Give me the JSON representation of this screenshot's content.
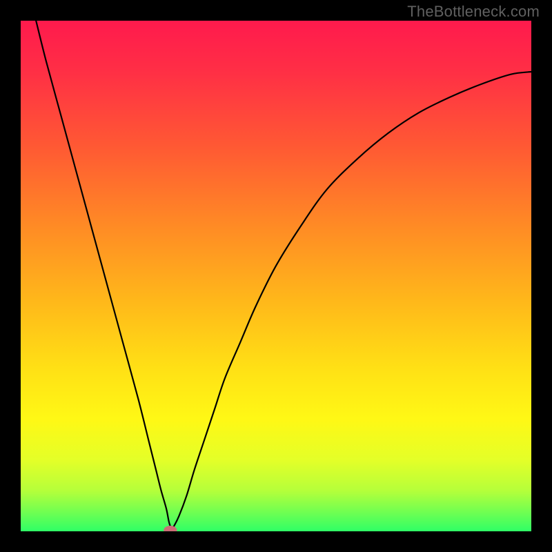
{
  "watermark": "TheBottleneck.com",
  "chart_data": {
    "type": "line",
    "title": "",
    "xlabel": "",
    "ylabel": "",
    "xlim": [
      0,
      100
    ],
    "ylim": [
      0,
      100
    ],
    "grid": false,
    "legend": false,
    "background_gradient": {
      "orientation": "vertical",
      "stops": [
        {
          "pos": 0.0,
          "color": "#ff1a4d"
        },
        {
          "pos": 0.1,
          "color": "#ff2f45"
        },
        {
          "pos": 0.25,
          "color": "#ff5a33"
        },
        {
          "pos": 0.4,
          "color": "#ff8a25"
        },
        {
          "pos": 0.55,
          "color": "#ffb81a"
        },
        {
          "pos": 0.68,
          "color": "#ffe015"
        },
        {
          "pos": 0.78,
          "color": "#fff815"
        },
        {
          "pos": 0.86,
          "color": "#e4ff28"
        },
        {
          "pos": 0.92,
          "color": "#b6ff3a"
        },
        {
          "pos": 0.96,
          "color": "#74ff50"
        },
        {
          "pos": 1.0,
          "color": "#2fff66"
        }
      ]
    },
    "series": [
      {
        "name": "bottleneck-curve",
        "color": "#000000",
        "x": [
          3,
          5,
          8,
          11,
          14,
          17,
          20,
          23,
          25,
          26.5,
          27.5,
          28.5,
          29,
          29.3,
          29.5,
          30,
          31,
          32.5,
          34,
          36,
          38,
          40,
          43,
          46,
          50,
          55,
          60,
          66,
          72,
          78,
          84,
          90,
          96,
          100
        ],
        "values": [
          100,
          92,
          81,
          70,
          59,
          48,
          37,
          26,
          18,
          12,
          8,
          4.5,
          2,
          1,
          0.5,
          1,
          3,
          7,
          12,
          18,
          24,
          30,
          37,
          44,
          52,
          60,
          67,
          73,
          78,
          82,
          85,
          87.5,
          89.5,
          90
        ]
      }
    ],
    "markers": [
      {
        "name": "valley-point",
        "x": 29.3,
        "y": 0.2,
        "color": "#cc6d76",
        "rx": 1.3,
        "ry": 0.9
      }
    ]
  }
}
